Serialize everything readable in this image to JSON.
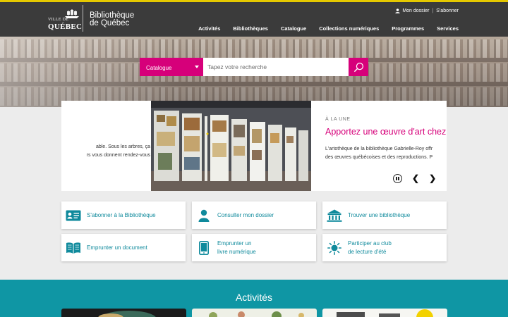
{
  "colors": {
    "accent": "#d6007a",
    "header_bg": "#3b3b3b",
    "top_line": "#e5c800",
    "teal": "#0f96a4",
    "link_teal": "#0f8a9c"
  },
  "header": {
    "logo_ville": "VILLE DE",
    "logo_quebec": "QUÉBEC",
    "logo_line1": "Bibliothèque",
    "logo_line2": "de Québec",
    "top_links": {
      "account": "Mon dossier",
      "separator": "|",
      "subscribe": "S'abonner"
    },
    "nav": [
      "Activités",
      "Bibliothèques",
      "Catalogue",
      "Collections numériques",
      "Programmes",
      "Services"
    ]
  },
  "search": {
    "category": "Catalogue",
    "placeholder": "Tapez votre recherche",
    "button_icon": "search-icon"
  },
  "slider": {
    "prev_text_line1": "able. Sous les arbres, ça",
    "prev_text_line2": "rs vous donnent rendez-vous",
    "kicker": "À LA UNE",
    "title": "Apportez une œuvre d'art chez",
    "desc_line1": "L'artothèque de la bibliothèque Gabrielle-Roy offr",
    "desc_line2": "des œuvres québécoises et des reproductions. P",
    "prev_label": "❮",
    "next_label": "❯"
  },
  "quick_links": [
    {
      "label1": "S'abonner à la Bibliothèque",
      "label2": "",
      "icon": "id-card-icon"
    },
    {
      "label1": "Consulter mon dossier",
      "label2": "",
      "icon": "user-icon"
    },
    {
      "label1": "Trouver une bibliothèque",
      "label2": "",
      "icon": "library-building-icon"
    },
    {
      "label1": "Emprunter un document",
      "label2": "",
      "icon": "open-book-icon"
    },
    {
      "label1": "Emprunter un",
      "label2": "livre numérique",
      "icon": "tablet-icon"
    },
    {
      "label1": "Participer au club",
      "label2": "de lecture d'été",
      "icon": "sun-icon"
    }
  ],
  "activities": {
    "title": "Activités"
  }
}
